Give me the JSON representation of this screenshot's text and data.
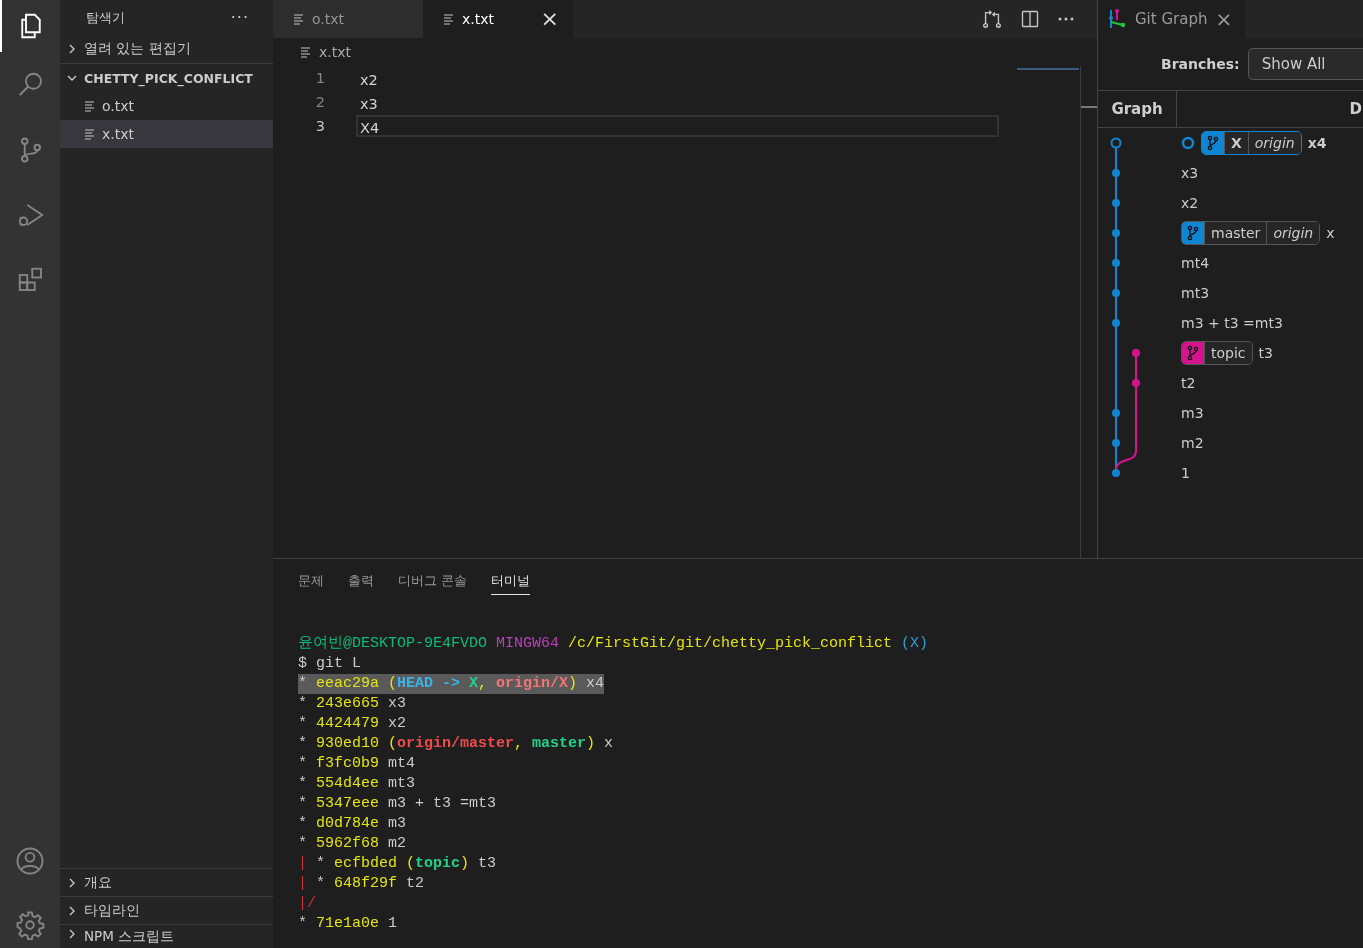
{
  "activity_bar": {
    "items": [
      {
        "kind": "explorer",
        "selected": true
      },
      {
        "kind": "search",
        "selected": false
      },
      {
        "kind": "source-control",
        "selected": false
      },
      {
        "kind": "run-debug",
        "selected": false
      },
      {
        "kind": "extensions",
        "selected": false
      }
    ]
  },
  "sidebar": {
    "title": "탐색기",
    "more": "···",
    "sections": [
      {
        "label": "열려 있는 편집기",
        "expanded": false
      },
      {
        "label": "CHETTY_PICK_CONFLICT",
        "expanded": true,
        "files": [
          {
            "name": "o.txt",
            "selected": false
          },
          {
            "name": "x.txt",
            "selected": true
          }
        ]
      }
    ],
    "bottom_sections": [
      {
        "label": "개요",
        "expanded": false
      },
      {
        "label": "타임라인",
        "expanded": false
      },
      {
        "label": "NPM 스크립트",
        "expanded": false
      }
    ]
  },
  "editor": {
    "tabs": [
      {
        "label": "o.txt",
        "selected": false
      },
      {
        "label": "x.txt",
        "selected": true,
        "close": "×"
      }
    ],
    "breadcrumb": "x.txt",
    "lines": [
      {
        "number": "1",
        "text": "x2",
        "current": false
      },
      {
        "number": "2",
        "text": "x3",
        "current": false
      },
      {
        "number": "3",
        "text": "X4",
        "current": true
      }
    ]
  },
  "git_graph": {
    "tab": {
      "label": "Git Graph",
      "close": "×"
    },
    "branches_label": "Branches:",
    "branches_value": "Show All",
    "columns": [
      "Graph",
      "D"
    ],
    "commits": [
      {
        "message": "x4",
        "kind": "main",
        "color": "#0e86d4",
        "current": true,
        "refs": [
          {
            "label": "X",
            "remote": "origin",
            "color": "#0e86d4"
          }
        ]
      },
      {
        "message": "x3",
        "kind": "main",
        "color": "#0e86d4",
        "current": false
      },
      {
        "message": "x2",
        "kind": "main",
        "color": "#0e86d4",
        "current": false
      },
      {
        "message": "x",
        "kind": "main",
        "color": "#0e86d4",
        "current": false,
        "refs": [
          {
            "label": "master",
            "remote": "origin",
            "color": "#0e86d4"
          }
        ]
      },
      {
        "message": "mt4",
        "kind": "main",
        "color": "#0e86d4",
        "current": false
      },
      {
        "message": "mt3",
        "kind": "main",
        "color": "#0e86d4",
        "current": false
      },
      {
        "message": "m3 + t3 =mt3",
        "kind": "main",
        "color": "#0e86d4",
        "current": false
      },
      {
        "message": "t3",
        "kind": "side",
        "color": "#d4148c",
        "current": false,
        "refs": [
          {
            "label": "topic",
            "color": "#d4148c"
          }
        ]
      },
      {
        "message": "t2",
        "kind": "side",
        "color": "#d4148c",
        "current": false
      },
      {
        "message": "m3",
        "kind": "main",
        "color": "#0e86d4",
        "current": false
      },
      {
        "message": "m2",
        "kind": "main",
        "color": "#0e86d4",
        "current": false
      },
      {
        "message": "1",
        "kind": "main",
        "color": "#0e86d4",
        "current": false
      }
    ]
  },
  "panel": {
    "tabs": [
      {
        "label": "문제",
        "selected": false
      },
      {
        "label": "출력",
        "selected": false
      },
      {
        "label": "디버그 콘솔",
        "selected": false
      },
      {
        "label": "터미널",
        "selected": true
      }
    ],
    "terminal": [
      {
        "highlighted": false,
        "segments": [
          {
            "text": "윤여빈@DESKTOP-9E4FVDO ",
            "color": "#0dbc79",
            "bold": false
          },
          {
            "text": "MINGW64 ",
            "color": "#bc3fbc",
            "bold": false
          },
          {
            "text": "/c/FirstGit/git/chetty_pick_conflict ",
            "color": "#e5e510",
            "bold": false
          },
          {
            "text": "(X)",
            "color": "#2a9fd6",
            "bold": false
          }
        ]
      },
      {
        "highlighted": false,
        "segments": [
          {
            "text": "$ git L",
            "bold": false
          }
        ]
      },
      {
        "highlighted": true,
        "segments": [
          {
            "text": "* ",
            "bold": false
          },
          {
            "text": "eeac29a (",
            "color": "#e5e510",
            "bold": false
          },
          {
            "text": "HEAD -> ",
            "color": "#3bb3e6",
            "bold": true
          },
          {
            "text": "X",
            "color": "#23d18b",
            "bold": true
          },
          {
            "text": ", ",
            "color": "#e5e510",
            "bold": false
          },
          {
            "text": "origin/X",
            "color": "#f47575",
            "bold": true
          },
          {
            "text": ")",
            "color": "#e5e510",
            "bold": false
          },
          {
            "text": " x4",
            "bold": false
          }
        ]
      },
      {
        "highlighted": false,
        "segments": [
          {
            "text": "* ",
            "bold": false
          },
          {
            "text": "243e665 ",
            "color": "#e5e510",
            "bold": false
          },
          {
            "text": "x3",
            "bold": false
          }
        ]
      },
      {
        "highlighted": false,
        "segments": [
          {
            "text": "* ",
            "bold": false
          },
          {
            "text": "4424479 ",
            "color": "#e5e510",
            "bold": false
          },
          {
            "text": "x2",
            "bold": false
          }
        ]
      },
      {
        "highlighted": false,
        "segments": [
          {
            "text": "* ",
            "bold": false
          },
          {
            "text": "930ed10 (",
            "color": "#e5e510",
            "bold": false
          },
          {
            "text": "origin/master",
            "color": "#f14c4c",
            "bold": true
          },
          {
            "text": ", ",
            "color": "#e5e510",
            "bold": false
          },
          {
            "text": "master",
            "color": "#23d18b",
            "bold": true
          },
          {
            "text": ")",
            "color": "#e5e510",
            "bold": false
          },
          {
            "text": " x",
            "bold": false
          }
        ]
      },
      {
        "highlighted": false,
        "segments": [
          {
            "text": "* ",
            "bold": false
          },
          {
            "text": "f3fc0b9 ",
            "color": "#e5e510",
            "bold": false
          },
          {
            "text": "mt4",
            "bold": false
          }
        ]
      },
      {
        "highlighted": false,
        "segments": [
          {
            "text": "* ",
            "bold": false
          },
          {
            "text": "554d4ee ",
            "color": "#e5e510",
            "bold": false
          },
          {
            "text": "mt3",
            "bold": false
          }
        ]
      },
      {
        "highlighted": false,
        "segments": [
          {
            "text": "* ",
            "bold": false
          },
          {
            "text": "5347eee ",
            "color": "#e5e510",
            "bold": false
          },
          {
            "text": "m3 + t3 =mt3",
            "bold": false
          }
        ]
      },
      {
        "highlighted": false,
        "segments": [
          {
            "text": "* ",
            "bold": false
          },
          {
            "text": "d0d784e ",
            "color": "#e5e510",
            "bold": false
          },
          {
            "text": "m3",
            "bold": false
          }
        ]
      },
      {
        "highlighted": false,
        "segments": [
          {
            "text": "* ",
            "bold": false
          },
          {
            "text": "5962f68 ",
            "color": "#e5e510",
            "bold": false
          },
          {
            "text": "m2",
            "bold": false
          }
        ]
      },
      {
        "highlighted": false,
        "segments": [
          {
            "text": "| ",
            "color": "#cd3131",
            "bold": false
          },
          {
            "text": "* ",
            "bold": false
          },
          {
            "text": "ecfbded (",
            "color": "#e5e510",
            "bold": false
          },
          {
            "text": "topic",
            "color": "#23d18b",
            "bold": true
          },
          {
            "text": ")",
            "color": "#e5e510",
            "bold": false
          },
          {
            "text": " t3",
            "bold": false
          }
        ]
      },
      {
        "highlighted": false,
        "segments": [
          {
            "text": "| ",
            "color": "#cd3131",
            "bold": false
          },
          {
            "text": "* ",
            "bold": false
          },
          {
            "text": "648f29f ",
            "color": "#e5e510",
            "bold": false
          },
          {
            "text": "t2",
            "bold": false
          }
        ]
      },
      {
        "highlighted": false,
        "segments": [
          {
            "text": "|/",
            "color": "#cd3131",
            "bold": false
          }
        ]
      },
      {
        "highlighted": false,
        "segments": [
          {
            "text": "* ",
            "bold": false
          },
          {
            "text": "71e1a0e ",
            "color": "#e5e510",
            "bold": false
          },
          {
            "text": "1",
            "bold": false
          }
        ]
      }
    ]
  }
}
